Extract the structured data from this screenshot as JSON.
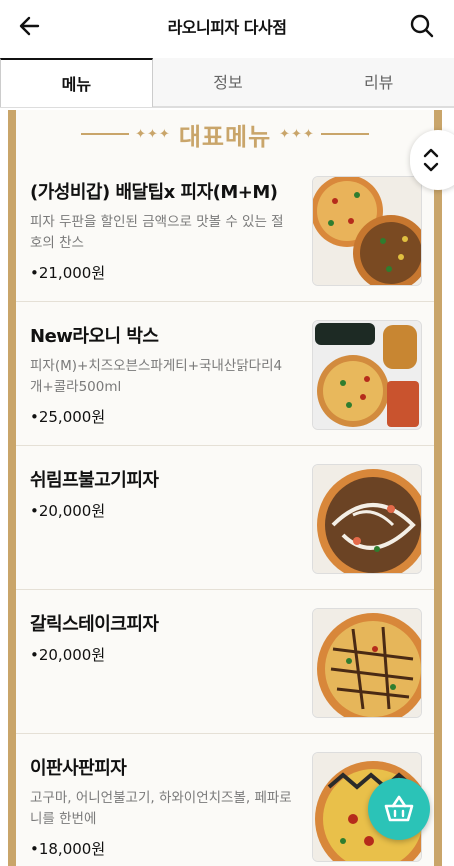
{
  "header": {
    "title": "라오니피자 다사점"
  },
  "tabs": [
    {
      "label": "메뉴",
      "active": true
    },
    {
      "label": "정보",
      "active": false
    },
    {
      "label": "리뷰",
      "active": false
    }
  ],
  "section": {
    "title": "대표메뉴",
    "ornament": "✦✦✦"
  },
  "items": [
    {
      "name": "(가성비갑) 배달팁x 피자(M+M)",
      "desc": "피자 두판을 할인된 금액으로 맛볼 수 있는 절호의 찬스",
      "price": "•21,000원"
    },
    {
      "name": "New라오니 박스",
      "desc": "피자(M)+치즈오븐스파게티+국내산닭다리4개+콜라500ml",
      "price": "•25,000원"
    },
    {
      "name": "쉬림프불고기피자",
      "desc": "",
      "price": "•20,000원"
    },
    {
      "name": "갈릭스테이크피자",
      "desc": "",
      "price": "•20,000원"
    },
    {
      "name": "이판사판피자",
      "desc": "고구마, 어니언불고기, 하와이언치즈볼, 페파로니를 한번에",
      "price": "•18,000원"
    }
  ],
  "icons": {
    "back": "arrow-left-icon",
    "search": "search-icon",
    "scroll": "chevron-up-down-icon",
    "cart": "basket-icon"
  },
  "colors": {
    "accent": "#c9a56a",
    "cart": "#2bc3b7"
  }
}
